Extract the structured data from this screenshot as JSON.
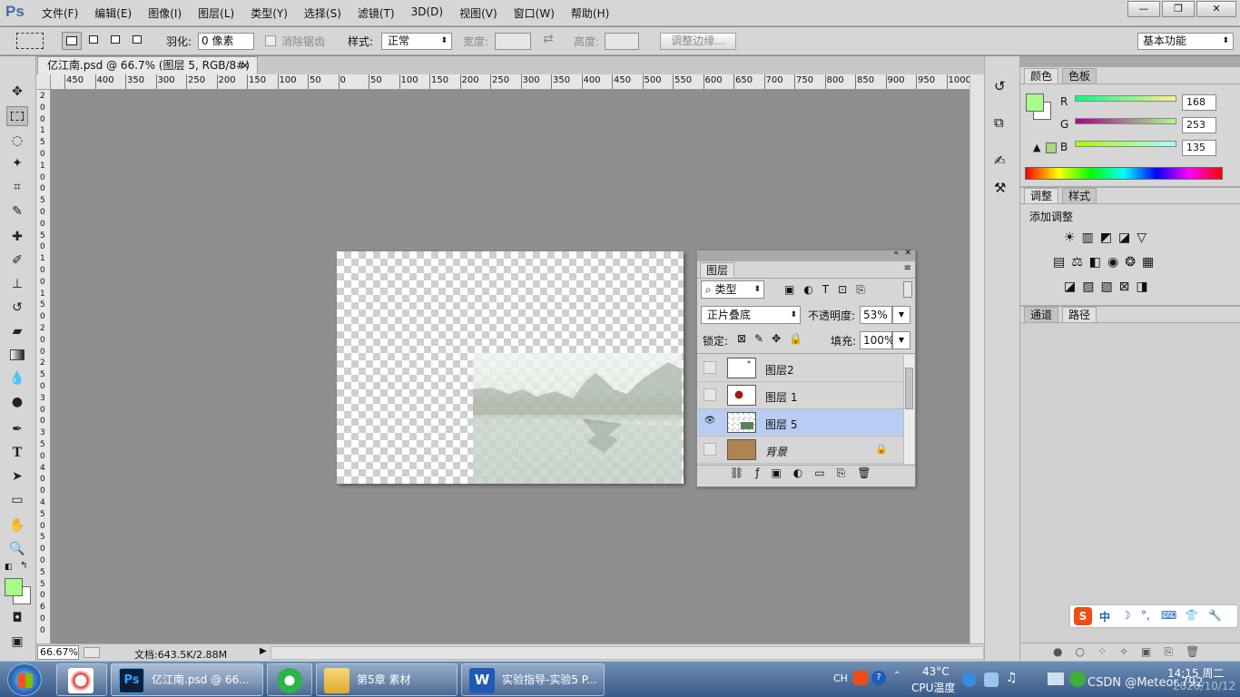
{
  "app": {
    "logo": "Ps",
    "menus": [
      "文件(F)",
      "编辑(E)",
      "图像(I)",
      "图层(L)",
      "类型(Y)",
      "选择(S)",
      "滤镜(T)",
      "3D(D)",
      "视图(V)",
      "窗口(W)",
      "帮助(H)"
    ],
    "window_controls": {
      "minimize": "—",
      "restore": "❐",
      "close": "✕"
    }
  },
  "options_bar": {
    "feather_label": "羽化:",
    "feather_value": "0 像素",
    "antialias_label": "消除锯齿",
    "style_label": "样式:",
    "style_value": "正常",
    "width_label": "宽度:",
    "height_label": "高度:",
    "refine_edge": "调整边缘...",
    "workspace": "基本功能"
  },
  "document": {
    "tab_title": "亿江南.psd @ 66.7% (图层 5, RGB/8#) *",
    "tab_close": "×",
    "ruler_labels": [
      "450",
      "400",
      "350",
      "300",
      "250",
      "200",
      "150",
      "100",
      "50",
      "0",
      "50",
      "100",
      "150",
      "200",
      "250",
      "300",
      "350",
      "400",
      "450",
      "500",
      "550",
      "600",
      "650",
      "700",
      "750",
      "800",
      "850",
      "900",
      "950",
      "1000"
    ],
    "left_ruler_digits": [
      "2",
      "0",
      "0",
      "1",
      "5",
      "0",
      "1",
      "0",
      "0",
      "5",
      "0",
      "0",
      "5",
      "0",
      "1",
      "0",
      "0",
      "1",
      "5",
      "0",
      "2",
      "0",
      "0",
      "2",
      "5",
      "0",
      "3",
      "0",
      "0",
      "3",
      "5",
      "0",
      "4",
      "0",
      "0",
      "4",
      "5",
      "0",
      "5",
      "0",
      "0",
      "5",
      "5",
      "0",
      "6",
      "0",
      "0"
    ],
    "zoom": "66.67%",
    "doc_info": "文档:643.5K/2.88M"
  },
  "layers_panel": {
    "tab": "图层",
    "filter_type": "类型",
    "blend_mode": "正片叠底",
    "opacity_label": "不透明度:",
    "opacity_value": "53%",
    "lock_label": "锁定:",
    "fill_label": "填充:",
    "fill_value": "100%",
    "layers": [
      {
        "name": "图层2",
        "visible": false,
        "selected": false
      },
      {
        "name": "图层 1",
        "visible": false,
        "selected": false
      },
      {
        "name": "图层 5",
        "visible": true,
        "selected": true
      },
      {
        "name": "背景",
        "visible": false,
        "selected": false,
        "locked": true
      }
    ],
    "eye_glyph": "👁"
  },
  "color_panel": {
    "tabs": [
      "颜色",
      "色板"
    ],
    "channels": [
      {
        "label": "R",
        "value": "168"
      },
      {
        "label": "G",
        "value": "253"
      },
      {
        "label": "B",
        "value": "135"
      }
    ],
    "foreground_color": "#a8fd87"
  },
  "adjust_panel": {
    "tabs": [
      "调整",
      "样式"
    ],
    "title": "添加调整"
  },
  "paths_panel": {
    "tabs": [
      "通道",
      "路径"
    ]
  },
  "ime": {
    "chars": [
      "S",
      "中",
      "☽",
      "°,",
      "⌨",
      "👕",
      "🔧"
    ]
  },
  "taskbar": {
    "items": [
      {
        "label": ""
      },
      {
        "label": "亿江南.psd @ 66..."
      },
      {
        "label": ""
      },
      {
        "label": "第5章 素材"
      },
      {
        "label": "实验指导-实验5 P..."
      }
    ],
    "tray": {
      "lang": "CH",
      "temp": "43°C",
      "temp_label": "CPU温度",
      "time": "14:15 周二",
      "date": "2020/10/12",
      "watermark": "CSDN @Meteor.792"
    }
  },
  "colors": {
    "ui_gray": "#d6d6d6",
    "canvas_bg": "#8f8f8f",
    "selected_layer": "#b8cdf2",
    "taskbar_top": "#6f8fb5",
    "taskbar_bottom": "#3a5a88"
  }
}
